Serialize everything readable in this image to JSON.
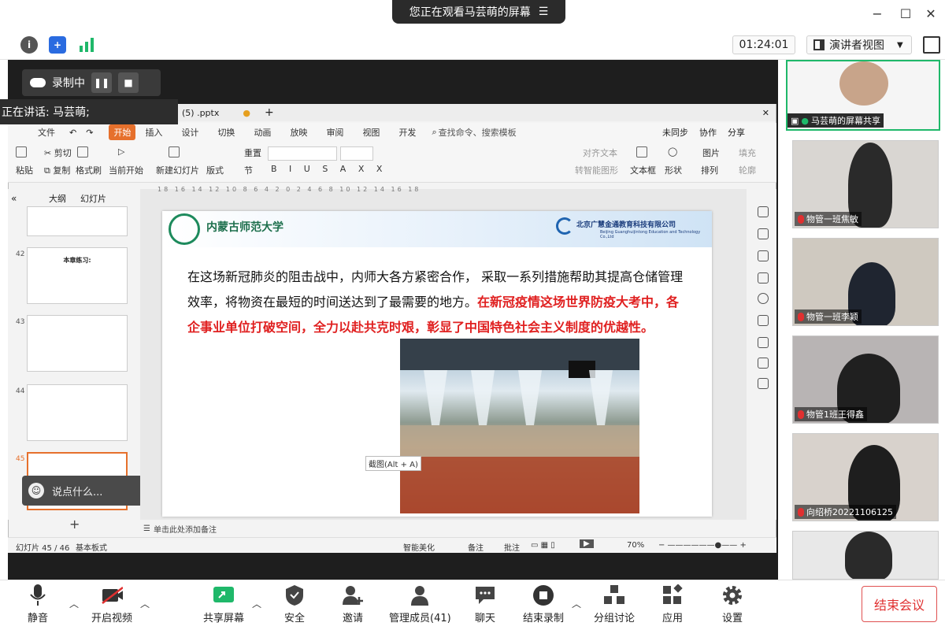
{
  "window": {
    "viewing_banner": "您正在观看马芸萌的屏幕",
    "minimize": "−",
    "maximize": "☐",
    "close": "✕"
  },
  "info": {
    "timer": "01:24:01",
    "view_mode": "演讲者视图"
  },
  "recording": {
    "label": "录制中",
    "speaking": "正在讲话: 马芸萌;"
  },
  "wps": {
    "file_tab": "(5) .pptx",
    "menu": [
      "文件",
      "开始",
      "插入",
      "设计",
      "切换",
      "动画",
      "放映",
      "审阅",
      "视图",
      "开发"
    ],
    "search_placeholder": "查找命令、搜索模板",
    "sync": "未同步",
    "collab": "协作",
    "share": "分享",
    "ribbon": {
      "paste": "粘贴",
      "cut": "剪切",
      "copy": "复制",
      "format_painter": "格式刷",
      "play_from_current": "当前开始",
      "new_slide": "新建幻灯片",
      "layout": "版式",
      "section": "节",
      "reset": "重置",
      "align_text": "对齐文本",
      "convert_smartart": "转智能图形",
      "text_box": "文本框",
      "shape": "形状",
      "arrange": "排列",
      "picture": "图片",
      "fill": "填充",
      "outline": "轮廓"
    },
    "panel_tabs": [
      "大纲",
      "幻灯片"
    ],
    "thumbs": [
      {
        "num": "42",
        "title": "本章练习:"
      },
      {
        "num": "43",
        "title": ""
      },
      {
        "num": "44",
        "title": ""
      },
      {
        "num": "45",
        "title": ""
      }
    ],
    "add_slide": "+",
    "notes_placeholder": "单击此处添加备注",
    "status": {
      "slide_count": "幻灯片 45 / 46",
      "theme": "基本板式",
      "beautify": "智能美化",
      "notes": "备注",
      "comments": "批注",
      "zoom": "70%"
    },
    "tooltip": "截图(Alt + A)"
  },
  "slide": {
    "school": "内蒙古师范大学",
    "company": "北京广慧金通教育科技有限公司",
    "company_en": "Beijing Guanghuijintong Education and Technology Co.,Ltd",
    "text_black": "在这场新冠肺炎的阻击战中，内师大各方紧密合作， 采取一系列措施帮助其提高仓储管理效率，将物资在最短的时间送达到了最需要的地方。",
    "text_red": "在新冠疫情这场世界防疫大考中，各企事业单位打破空间，全力以赴共克时艰，彰显了中国特色社会主义制度的优越性。"
  },
  "chat": {
    "placeholder": "说点什么..."
  },
  "participants": [
    {
      "name": "马芸萌的屏幕共享",
      "sharing": true
    },
    {
      "name": "物管一班焦敏",
      "muted": true
    },
    {
      "name": "物管一班李颖",
      "muted": true
    },
    {
      "name": "物管1班王得鑫",
      "muted": true
    },
    {
      "name": "向绍桥20221106125",
      "muted": true
    }
  ],
  "toolbar": {
    "mute": "静音",
    "video": "开启视频",
    "share": "共享屏幕",
    "security": "安全",
    "invite": "邀请",
    "members": "管理成员(41)",
    "chat": "聊天",
    "end_record": "结束录制",
    "breakout": "分组讨论",
    "apps": "应用",
    "settings": "设置",
    "end_meeting": "结束会议"
  },
  "colors": {
    "accent_green": "#1fb86a",
    "brand_orange": "#e6702c",
    "slide_red": "#e02020",
    "end_red": "#e03030"
  }
}
